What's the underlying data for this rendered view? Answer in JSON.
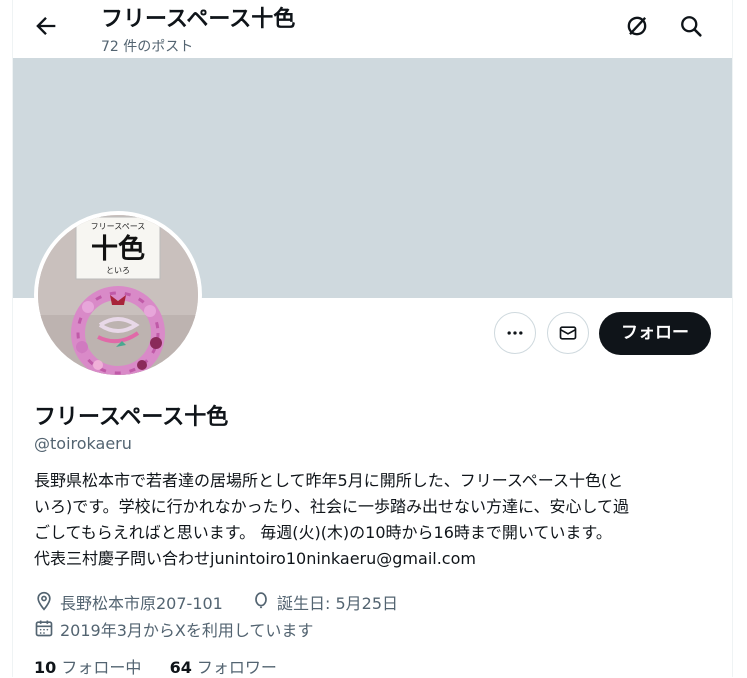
{
  "header": {
    "title": "フリースペース十色",
    "post_count": "72 件のポスト",
    "back_icon": "arrow-left-icon",
    "icons": [
      "grok-icon",
      "search-icon"
    ]
  },
  "banner": {
    "color": "#cfd9de"
  },
  "avatar": {
    "sign_top": "フリースペース",
    "sign_main": "十色",
    "sign_sub": "といろ"
  },
  "actions": {
    "more_icon": "more-icon",
    "message_icon": "mail-icon",
    "follow_label": "フォロー"
  },
  "profile": {
    "name": "フリースペース十色",
    "handle": "@toirokaeru",
    "bio_lines": [
      "長野県松本市で若者達の居場所として昨年5月に開所した、フリースペース十色(と",
      "いろ)です。学校に行かれなかったり、社会に一歩踏み出せない方達に、安心して過",
      "ごしてもらえればと思います。 毎週(火)(木)の10時から16時まで開いています。",
      "代表三村慶子問い合わせjunintoiro10ninkaeru@gmail.com"
    ],
    "location": "長野松本市原207-101",
    "birthday": "誕生日: 5月25日",
    "joined": "2019年3月からXを利用しています"
  },
  "stats": {
    "following_count": "10",
    "following_label": "フォロー中",
    "followers_count": "64",
    "followers_label": "フォロワー"
  },
  "colors": {
    "text": "#0f1419",
    "muted": "#536471",
    "border": "#cfd9de"
  }
}
